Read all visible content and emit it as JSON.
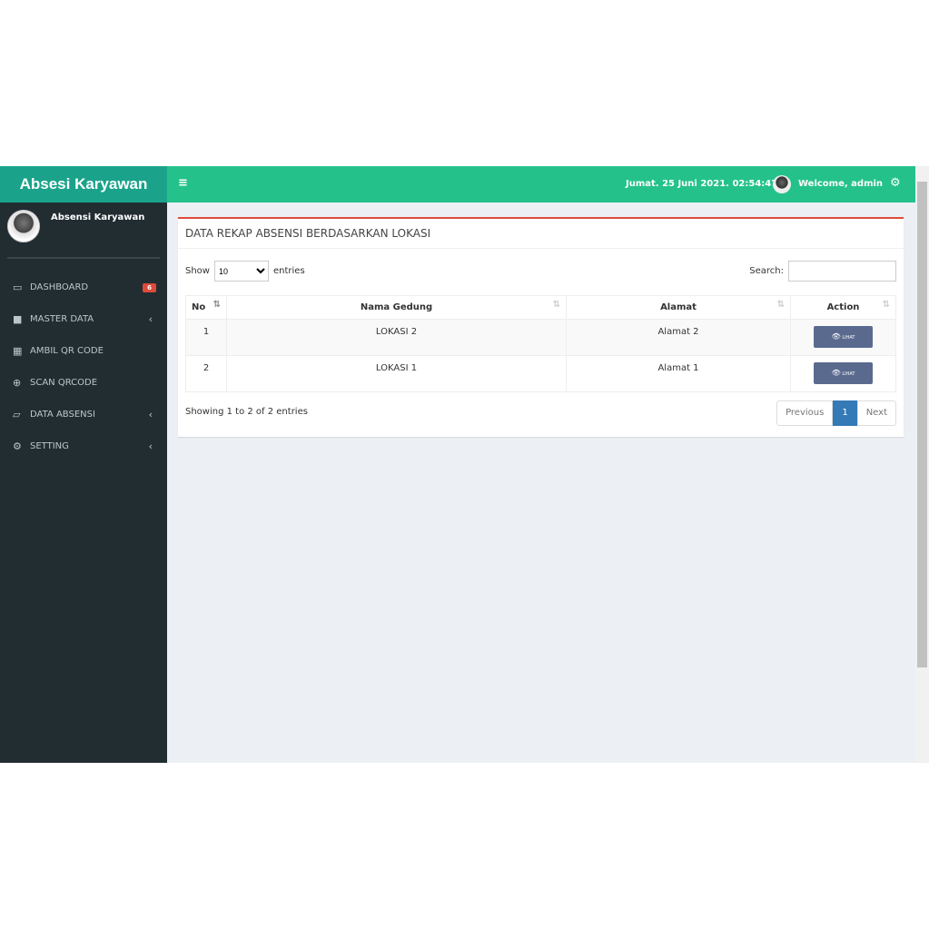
{
  "app": {
    "logo": "Absesi Karyawan",
    "user": "Absensi Karyawan"
  },
  "sidebar": {
    "items": [
      {
        "icon": "laptop-icon",
        "label": "DASHBOARD",
        "badge": "6"
      },
      {
        "icon": "folder-icon",
        "label": "MASTER DATA"
      },
      {
        "icon": "qrcode-icon",
        "label": "AMBIL QR CODE"
      },
      {
        "icon": "search-plus-icon",
        "label": "SCAN QRCODE"
      },
      {
        "icon": "folder-open-icon",
        "label": "DATA ABSENSI"
      },
      {
        "icon": "gears-icon",
        "label": "SETTING"
      }
    ]
  },
  "topbar": {
    "datetime": "Jumat. 25 Juni 2021. 02:54:47",
    "welcome": "Welcome, admin"
  },
  "box": {
    "title": "DATA REKAP ABSENSI BERDASARKAN LOKASI",
    "show": "Show",
    "entries_value": "10",
    "entries": "entries",
    "search_label": "Search:",
    "search_value": "",
    "columns": [
      "No",
      "Nama Gedung",
      "Alamat",
      "Action"
    ],
    "rows": [
      {
        "no": "1",
        "nama": "LOKASI 2",
        "alamat": "Alamat 2",
        "action": "LIHAT"
      },
      {
        "no": "2",
        "nama": "LOKASI 1",
        "alamat": "Alamat 1",
        "action": "LIHAT"
      }
    ],
    "info": "Showing 1 to 2 of 2 entries",
    "prev": "Previous",
    "page": "1",
    "next": "Next"
  }
}
